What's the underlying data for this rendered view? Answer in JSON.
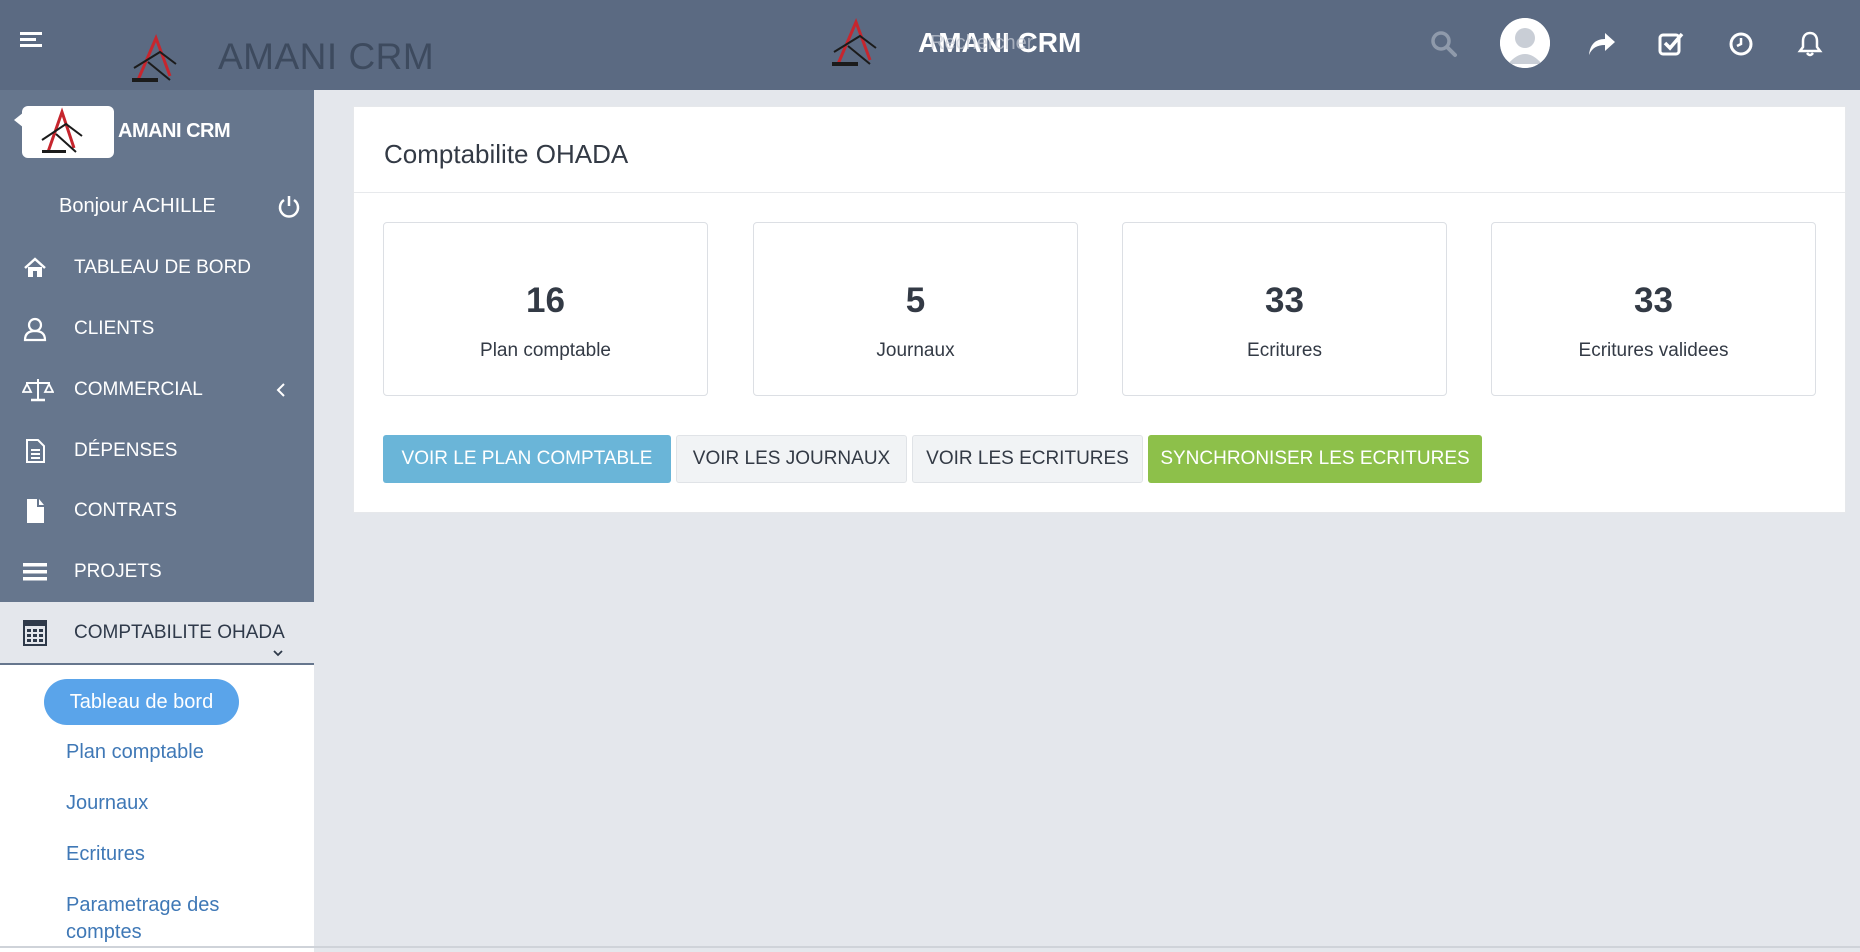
{
  "colors": {
    "topbar": "#5b6a82",
    "sidebar": "#66768d",
    "accent_blue": "#6ab5d8",
    "accent_green": "#8dc04a",
    "pill": "#5aa4ea",
    "link": "#3f78b6"
  },
  "topbar": {
    "title_left": "AMANI CRM",
    "title_center": "AMANI CRM",
    "search_overlay": "Rechercher",
    "icons": [
      "hamburger-icon",
      "search-icon",
      "avatar",
      "share-icon",
      "checkbox-icon",
      "clock-icon",
      "bell-icon"
    ]
  },
  "sidebar": {
    "brand": "AMANI CRM",
    "greeting": "Bonjour ACHILLE",
    "items": [
      {
        "label": "TABLEAU DE BORD",
        "icon": "home-icon"
      },
      {
        "label": "CLIENTS",
        "icon": "user-icon"
      },
      {
        "label": "COMMERCIAL",
        "icon": "balance-scale-icon"
      },
      {
        "label": "DÉPENSES",
        "icon": "document-icon"
      },
      {
        "label": "CONTRATS",
        "icon": "file-icon"
      },
      {
        "label": "PROJETS",
        "icon": "bars-icon"
      },
      {
        "label": "COMPTABILITE OHADA",
        "icon": "calculator-icon"
      }
    ],
    "submenu": [
      "Tableau de bord",
      "Plan comptable",
      "Journaux",
      "Ecritures",
      "Parametrage des",
      "comptes"
    ]
  },
  "main": {
    "title": "Comptabilite OHADA",
    "stats": [
      {
        "value": "16",
        "label": "Plan comptable"
      },
      {
        "value": "5",
        "label": "Journaux"
      },
      {
        "value": "33",
        "label": "Ecritures"
      },
      {
        "value": "33",
        "label": "Ecritures validees"
      }
    ],
    "buttons": [
      "VOIR LE PLAN COMPTABLE",
      "VOIR LES JOURNAUX",
      "VOIR LES ECRITURES",
      "SYNCHRONISER LES ECRITURES"
    ]
  }
}
